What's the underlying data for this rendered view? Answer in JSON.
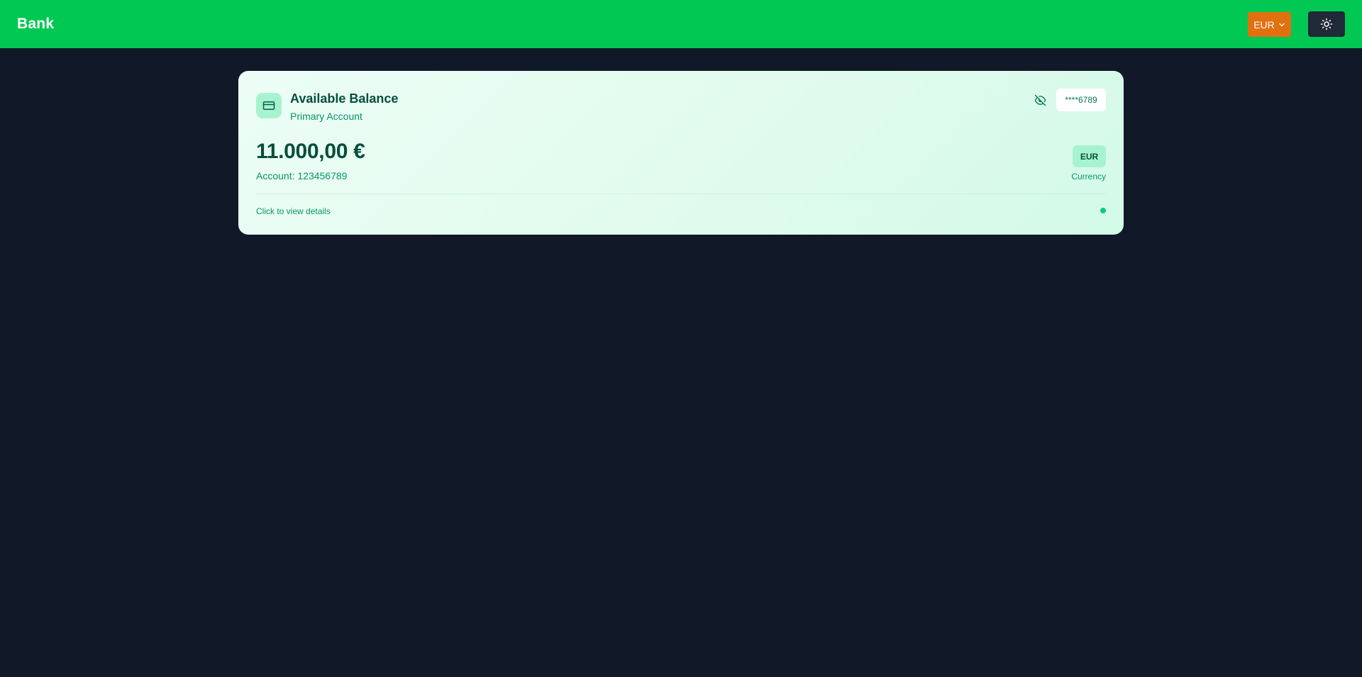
{
  "header": {
    "brand": "Bank",
    "currency_selector": {
      "selected": "EUR",
      "icon": "chevron-down-icon"
    },
    "theme_toggle": {
      "icon": "sun-icon"
    }
  },
  "balance_card": {
    "icon": "credit-card-icon",
    "title": "Available Balance",
    "subtitle": "Primary Account",
    "visibility_icon": "eye-off-icon",
    "masked_account": "****6789",
    "balance": "11.000,00 €",
    "account_label": "Account: 123456789",
    "currency_code": "EUR",
    "currency_label": "Currency",
    "footer_hint": "Click to view details"
  },
  "colors": {
    "header_bg": "#00c853",
    "page_bg": "#111827",
    "currency_button": "#e1700f",
    "theme_button": "#1f2937",
    "card_text_dark": "#064e3b",
    "card_text_accent": "#059669",
    "status_dot": "#10c98a"
  }
}
